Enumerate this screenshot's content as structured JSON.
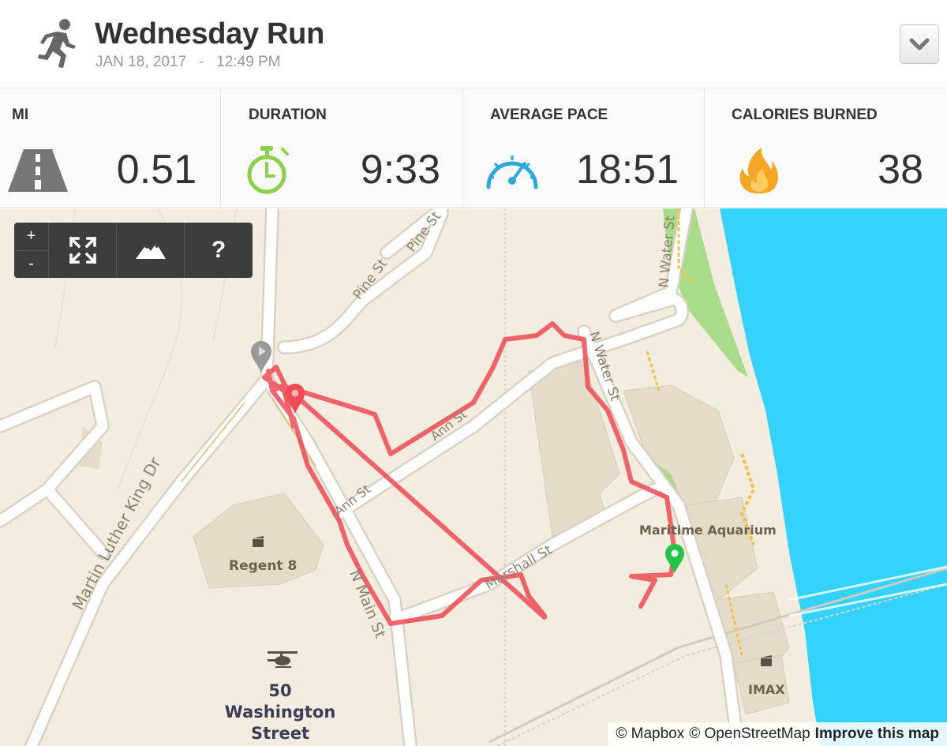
{
  "header": {
    "title": "Wednesday Run",
    "date": "JAN 18, 2017",
    "separator": "-",
    "time": "12:49 PM"
  },
  "stats": {
    "distance": {
      "label": "MI",
      "value": "0.51"
    },
    "duration": {
      "label": "DURATION",
      "value": "9:33"
    },
    "pace": {
      "label": "AVERAGE PACE",
      "value": "18:51"
    },
    "calories": {
      "label": "CALORIES BURNED",
      "value": "38"
    }
  },
  "map": {
    "controls": {
      "zoom_in": "+",
      "zoom_out": "-",
      "help": "?"
    },
    "places": {
      "regent": "Regent 8",
      "aquarium": "Maritime Aquarium",
      "heliport_line1": "50 Washington",
      "heliport_line2": "Street Heliport",
      "imax": "IMAX"
    },
    "streets": {
      "mlk": "Martin Luther King Dr",
      "pine1": "Pine St",
      "pine2": "Pine St",
      "ann1": "Ann St",
      "ann2": "Ann St",
      "water1": "N Water St",
      "water2": "N Water St",
      "main": "N Main St",
      "marshall": "Marshall St"
    },
    "attribution": {
      "mapbox": "© Mapbox",
      "osm": "© OpenStreetMap",
      "improve": "Improve this map"
    }
  },
  "colors": {
    "route": "#f04a55",
    "water": "#35d3fb",
    "park": "#a8dc8a",
    "land": "#f2eddf",
    "timer_icon": "#8bd04a",
    "pace_icon": "#2aa8e0",
    "fire_icon": "#f5a623"
  },
  "icons": [
    "runner-icon",
    "chevron-down-icon",
    "road-icon",
    "stopwatch-icon",
    "speedometer-icon",
    "fire-icon",
    "fullscreen-icon",
    "terrain-icon",
    "start-pin-icon",
    "finish-pin-icon",
    "marker-pin-icon",
    "cinema-icon",
    "helicopter-icon"
  ]
}
